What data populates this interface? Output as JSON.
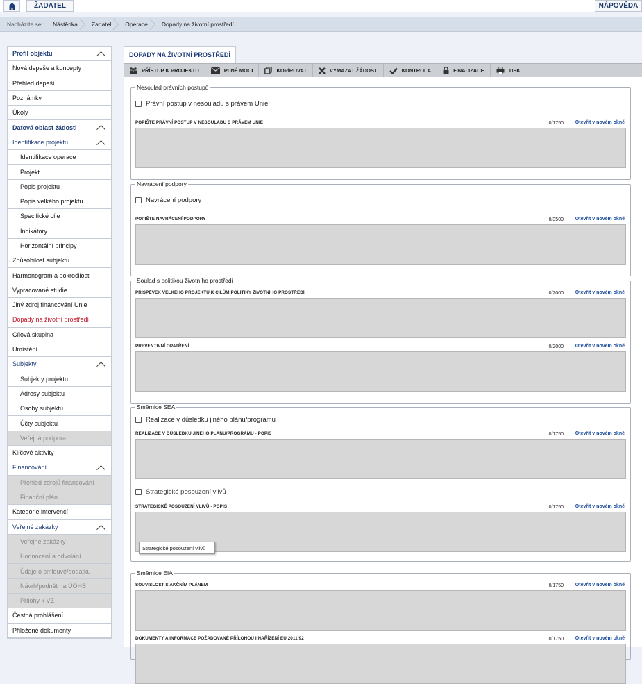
{
  "topbar": {
    "role": "ŽADATEL",
    "help": "NÁPOVĚDA"
  },
  "breadcrumb": {
    "label": "Nacházíte se:",
    "items": [
      "Nástěnka",
      "Žadatel",
      "Operace",
      "Dopady na životní prostředí"
    ]
  },
  "sidebar": {
    "items": [
      {
        "label": "Profil objektu",
        "type": "head",
        "chev": true
      },
      {
        "label": "Nová depeše a koncepty",
        "type": "item"
      },
      {
        "label": "Přehled depeší",
        "type": "item"
      },
      {
        "label": "Poznámky",
        "type": "item"
      },
      {
        "label": "Úkoly",
        "type": "item"
      },
      {
        "label": "Datová oblast žádosti",
        "type": "head",
        "chev": true
      },
      {
        "label": "Identifikace projektu",
        "type": "head2",
        "chev": true
      },
      {
        "label": "Identifikace operace",
        "type": "sub"
      },
      {
        "label": "Projekt",
        "type": "sub"
      },
      {
        "label": "Popis projektu",
        "type": "sub"
      },
      {
        "label": "Popis velkého projektu",
        "type": "sub"
      },
      {
        "label": "Specifické cíle",
        "type": "sub"
      },
      {
        "label": "Indikátory",
        "type": "sub"
      },
      {
        "label": "Horizontální principy",
        "type": "sub"
      },
      {
        "label": "Způsobilost subjektu",
        "type": "item"
      },
      {
        "label": "Harmonogram a pokročilost",
        "type": "item"
      },
      {
        "label": "Vypracované studie",
        "type": "item"
      },
      {
        "label": "Jiný zdroj financování Unie",
        "type": "item"
      },
      {
        "label": "Dopady na životní prostředí",
        "type": "active"
      },
      {
        "label": "Cílová skupina",
        "type": "item"
      },
      {
        "label": "Umístění",
        "type": "item"
      },
      {
        "label": "Subjekty",
        "type": "head2",
        "chev": true
      },
      {
        "label": "Subjekty projektu",
        "type": "sub"
      },
      {
        "label": "Adresy subjektu",
        "type": "sub"
      },
      {
        "label": "Osoby subjektu",
        "type": "sub"
      },
      {
        "label": "Účty subjektu",
        "type": "sub"
      },
      {
        "label": "Veřejná podpora",
        "type": "subdis"
      },
      {
        "label": "Klíčové aktivity",
        "type": "item"
      },
      {
        "label": "Financování",
        "type": "head2",
        "chev": true
      },
      {
        "label": "Přehled zdrojů financování",
        "type": "subdis"
      },
      {
        "label": "Finanční plán",
        "type": "subdis"
      },
      {
        "label": "Kategorie intervencí",
        "type": "item"
      },
      {
        "label": "Veřejné zakázky",
        "type": "head2",
        "chev": true
      },
      {
        "label": "Veřejné zakázky",
        "type": "subdis"
      },
      {
        "label": "Hodnocení a odvolání",
        "type": "subdis"
      },
      {
        "label": "Údaje o smlouvě/dodatku",
        "type": "subdis"
      },
      {
        "label": "Návrh/podnět na ÚOHS",
        "type": "subdis"
      },
      {
        "label": "Přílohy k VZ",
        "type": "subdis"
      },
      {
        "label": "Čestná prohlášení",
        "type": "item"
      },
      {
        "label": "Přiložené dokumenty",
        "type": "item"
      }
    ]
  },
  "tab": {
    "title": "DOPADY NA ŽIVOTNÍ PROSTŘEDÍ"
  },
  "toolbar": {
    "access": "PŘÍSTUP K PROJEKTU",
    "power": "PLNÉ MOCI",
    "copy": "KOPÍROVAT",
    "delete": "VYMAZAT ŽÁDOST",
    "check": "KONTROLA",
    "finalize": "FINALIZACE",
    "print": "TISK"
  },
  "open_link": "Otevřít v novém okně",
  "sections": {
    "nesoulad": {
      "legend": "Nesoulad právních postupů",
      "checkbox": "Právní postup v nesouladu s právem Unie",
      "field": "POPIŠTE PRÁVNÍ POSTUP V NESOULADU S PRÁVEM UNIE",
      "count": "0/1750"
    },
    "navraceni": {
      "legend": "Navrácení podpory",
      "checkbox": "Navrácení podpory",
      "field": "POPIŠTE NAVRÁCENÍ PODPORY",
      "count": "0/3500"
    },
    "soulad": {
      "legend": "Soulad s politikou životního prostředí",
      "field1": "PŘÍSPĚVEK VELKÉHO PROJEKTU K CÍLŮM POLITIKY ŽIVOTNÍHO PROSTŘEDÍ",
      "count1": "0/2000",
      "field2": "PREVENTIVNÍ OPATŘENÍ",
      "count2": "0/2000"
    },
    "sea": {
      "legend": "Směrnice SEA",
      "checkbox1": "Realizace v důsledku jiného plánu/programu",
      "field1": "REALIZACE V DŮSLEDKU JINÉHO PLÁNU/PROGRAMU - POPIS",
      "count1": "0/1750",
      "checkbox2": "Strategické posouzení vlivů",
      "field2": "STRATEGICKÉ POSOUZENÍ VLIVŮ - POPIS",
      "count2": "0/1750"
    },
    "eia": {
      "legend": "Směrnice EIA",
      "field1": "SOUVISLOST S AKČNÍM PLÁNEM",
      "count1": "0/1750",
      "field2": "DOKUMENTY A INFORMACE POŽADOVANÉ PŘÍLOHOU I NAŘÍZENÍ EU 2011/92",
      "count2": "0/1750"
    }
  },
  "tooltip": "Strategické posouzení vlivů"
}
